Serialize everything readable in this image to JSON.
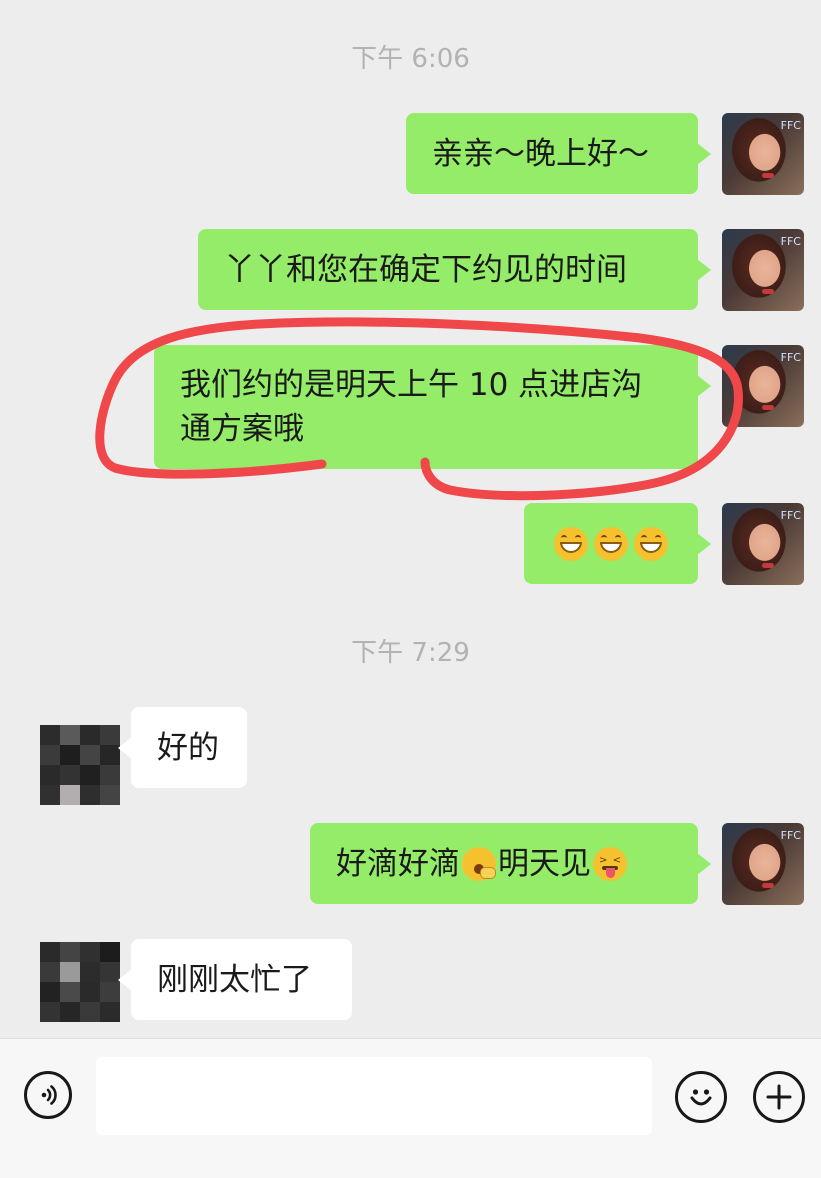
{
  "timestamps": [
    "下午 6:06",
    "下午 7:29"
  ],
  "messages": [
    {
      "side": "me",
      "text": "亲亲～晚上好～"
    },
    {
      "side": "me",
      "text": "丫丫和您在确定下约见的时间"
    },
    {
      "side": "me",
      "text_line1": "我们约的是明天上午 10 点进店沟",
      "text_line2": "通方案哦"
    },
    {
      "side": "me",
      "emoji": [
        "grinning-face",
        "grinning-face",
        "grinning-face"
      ]
    },
    {
      "side": "them",
      "text": "好的"
    },
    {
      "side": "me",
      "text_a": "好滴好滴",
      "emoji_a": "yawning-face",
      "text_b": "明天见",
      "emoji_b": "squinting-tongue-face"
    },
    {
      "side": "them",
      "text": "刚刚太忙了"
    }
  ],
  "annotation": {
    "color": "#f0474b",
    "shape": "hand-drawn-ellipse"
  },
  "colors": {
    "bubble_me": "#95ec69",
    "bubble_them": "#ffffff",
    "background": "#ededed"
  },
  "input_bar": {
    "voice_icon": "voice-icon",
    "emoji_icon": "emoji-icon",
    "plus_icon": "plus-icon",
    "value": ""
  }
}
